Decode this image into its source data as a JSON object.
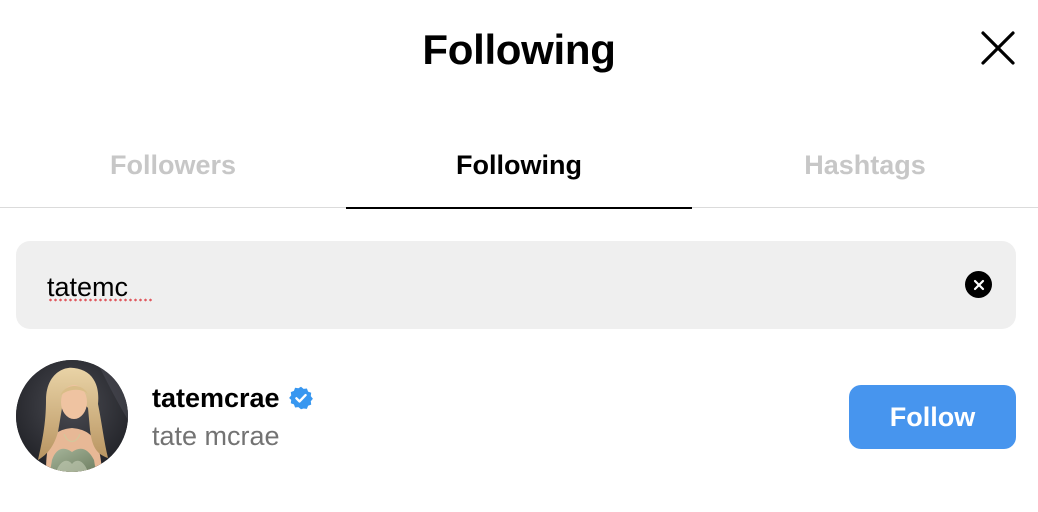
{
  "header": {
    "title": "Following",
    "close_icon": "close-icon"
  },
  "tabs": [
    {
      "label": "Followers",
      "active": false
    },
    {
      "label": "Following",
      "active": true
    },
    {
      "label": "Hashtags",
      "active": false
    }
  ],
  "search": {
    "value": "tatemc",
    "placeholder": "Search",
    "clear_icon": "clear-circle-icon"
  },
  "results": [
    {
      "username": "tatemcrae",
      "verified": true,
      "full_name": "tate mcrae",
      "action_label": "Follow"
    }
  ],
  "colors": {
    "primary_button": "#4795ee",
    "verified_badge": "#3897f0",
    "inactive_tab": "#c7c7c7",
    "secondary_text": "#737373",
    "search_background": "#efefef"
  }
}
